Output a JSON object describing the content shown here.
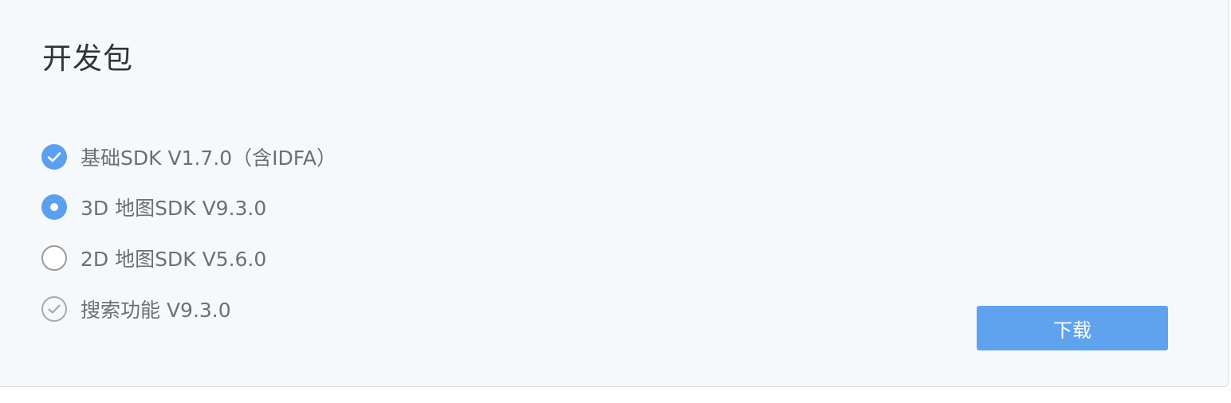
{
  "title": "开发包",
  "options": [
    {
      "label": "基础SDK V1.7.0（含IDFA）",
      "state": "checked",
      "icon": "check-circle-icon"
    },
    {
      "label": "3D 地图SDK V9.3.0",
      "state": "radio-selected",
      "icon": "radio-selected-icon"
    },
    {
      "label": "2D 地图SDK V5.6.0",
      "state": "radio-unselected",
      "icon": "radio-unselected-icon"
    },
    {
      "label": "搜索功能 V9.3.0",
      "state": "checked-disabled",
      "icon": "check-circle-outline-icon"
    }
  ],
  "download": {
    "label": "下载"
  },
  "colors": {
    "accent": "#5b9ff0",
    "button": "#5fa3ef",
    "text": "#6f6f6f",
    "title": "#333333",
    "panel_bg": "#f6f9fc"
  }
}
